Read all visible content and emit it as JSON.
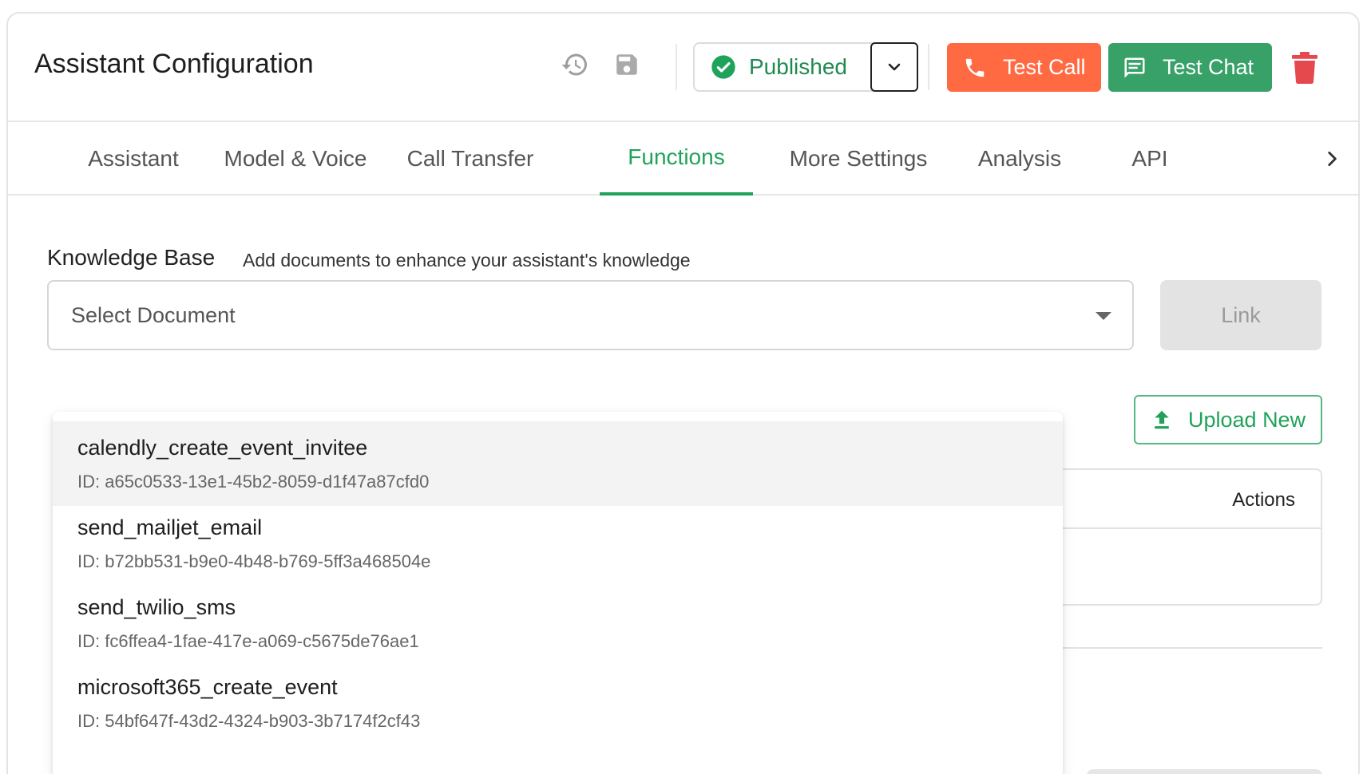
{
  "header": {
    "title": "Assistant Configuration",
    "status_label": "Published",
    "test_call_label": "Test Call",
    "test_chat_label": "Test Chat"
  },
  "tabs": [
    {
      "label": "Assistant"
    },
    {
      "label": "Model & Voice"
    },
    {
      "label": "Call Transfer"
    },
    {
      "label": "Functions"
    },
    {
      "label": "More Settings"
    },
    {
      "label": "Analysis"
    },
    {
      "label": "API"
    }
  ],
  "active_tab": "Functions",
  "knowledge_base": {
    "title": "Knowledge Base",
    "subtitle": "Add documents to enhance your assistant's knowledge",
    "select_placeholder": "Select Document",
    "link_label": "Link",
    "upload_label": "Upload New",
    "table_actions_header": "Actions"
  },
  "dropdown_items": [
    {
      "name": "calendly_create_event_invitee",
      "id": "ID: a65c0533-13e1-45b2-8059-d1f47a87cfd0"
    },
    {
      "name": "send_mailjet_email",
      "id": "ID: b72bb531-b9e0-4b48-b769-5ff3a468504e"
    },
    {
      "name": "send_twilio_sms",
      "id": "ID: fc6ffea4-1fae-417e-a069-c5675de76ae1"
    },
    {
      "name": "microsoft365_create_event",
      "id": "ID: 54bf647f-43d2-4324-b903-3b7174f2cf43"
    }
  ],
  "colors": {
    "accent_green": "#1fa35a",
    "test_call": "#ff6a43",
    "test_chat": "#37a168",
    "delete": "#e5484d"
  },
  "icons": [
    "history-icon",
    "save-icon",
    "check-circle-icon",
    "chevron-down-icon",
    "phone-icon",
    "chat-icon",
    "trash-icon",
    "chevron-right-icon",
    "upload-icon",
    "caret-down-icon"
  ]
}
